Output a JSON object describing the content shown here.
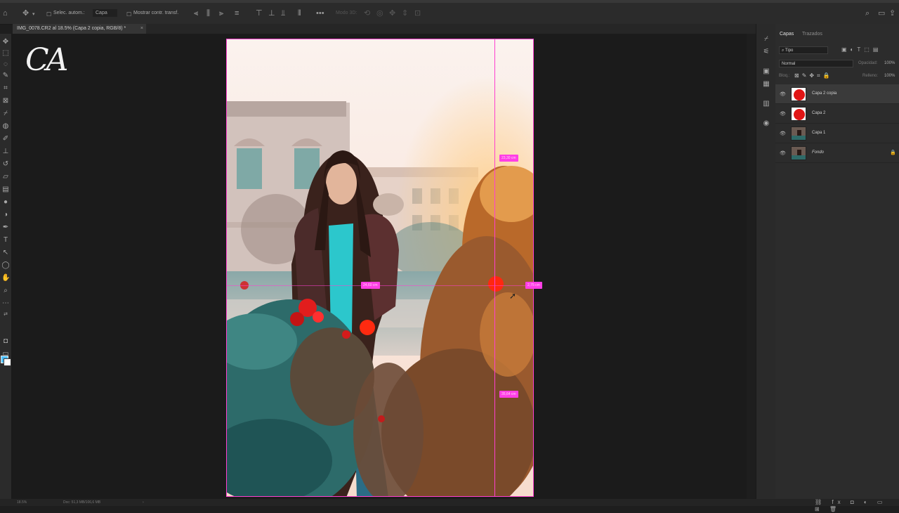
{
  "options_bar": {
    "auto_select": "Selec. autom.:",
    "target": "Capa",
    "show_transform": "Mostrar contr. transf.",
    "mode_3d": "Modo 3D:"
  },
  "document_tab": {
    "title": "IMG_0078.CR2 al 18.5% (Capa 2 copia, RGB/8) *",
    "close": "×"
  },
  "logo": {
    "text": "CA"
  },
  "measurements": {
    "top": "23,30 cm",
    "left": "24,60 cm",
    "right": "2,75 cm",
    "bottom": "35,64 cm"
  },
  "layers_panel": {
    "tabs": [
      "Capas",
      "Trazados"
    ],
    "filter_kind": "Tipo",
    "blend_mode": "Normal",
    "opacity_label": "Opacidad:",
    "opacity_value": "100%",
    "lock_label": "Bloq.:",
    "fill_label": "Relleno:",
    "fill_value": "100%",
    "layers": [
      {
        "name": "Capa 2 copia",
        "thumb": "rose",
        "selected": true
      },
      {
        "name": "Capa 2",
        "thumb": "rose",
        "selected": false
      },
      {
        "name": "Capa 1",
        "thumb": "photo",
        "selected": false
      },
      {
        "name": "Fondo",
        "thumb": "photo",
        "selected": false,
        "locked": true
      }
    ]
  },
  "status_bar": {
    "zoom": "18.5%",
    "doc": "Doc: 51,3 MB/106,6 MB"
  },
  "colors": {
    "guide": "#ff40d0",
    "measure_badge": "#ff3ee6",
    "foreground": "#4fc1ff",
    "background": "#ffffff"
  }
}
